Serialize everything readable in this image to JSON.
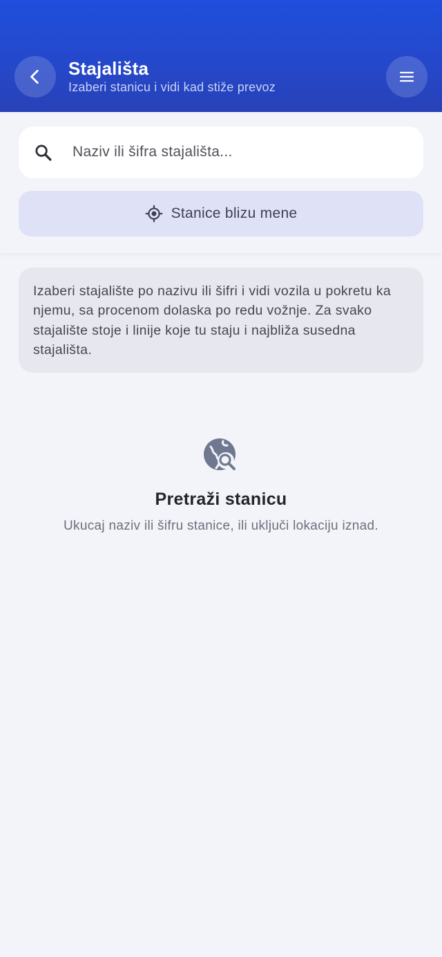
{
  "header": {
    "title": "Stajališta",
    "subtitle": "Izaberi stanicu i vidi kad stiže prevoz",
    "back_icon": "chevron-left-icon",
    "menu_icon": "hamburger-menu-icon"
  },
  "search": {
    "placeholder": "Naziv ili šifra stajališta...",
    "value": "",
    "icon": "search-icon"
  },
  "nearby": {
    "label": "Stanice blizu mene",
    "icon": "locate-crosshair-icon"
  },
  "info": {
    "text": "Izaberi stajalište po nazivu ili šifri i vidi vozila u pokretu ka njemu, sa procenom dolaska po redu vožnje. Za svako stajalište stoje i linije koje tu staju i najbliža susedna stajališta."
  },
  "empty_state": {
    "icon": "globe-search-icon",
    "title": "Pretraži stanicu",
    "subtitle": "Ukucaj naziv ili šifru stanice, ili uključi lokaciju iznad."
  },
  "colors": {
    "header_top": "#1f4fdc",
    "header_bottom": "#2842b8",
    "background": "#f3f4f9",
    "nearby_button": "#dfe2f7",
    "info_card": "#e7e8ef"
  }
}
